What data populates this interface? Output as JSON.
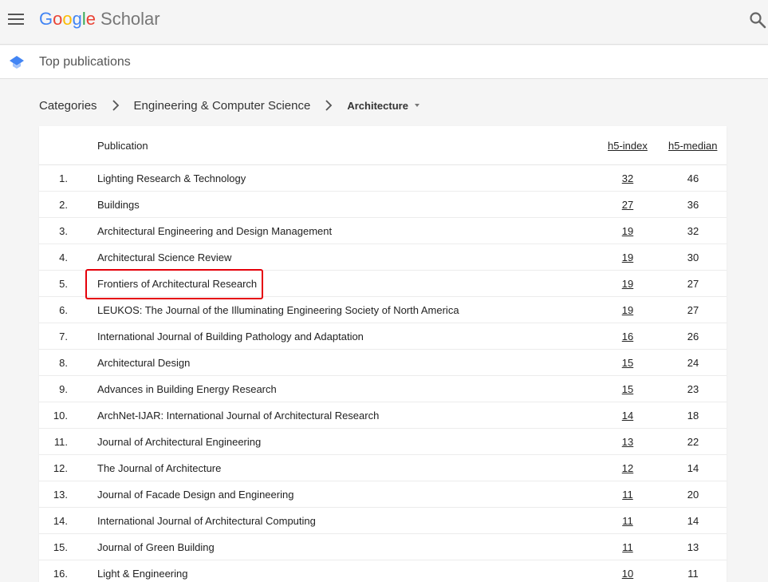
{
  "header": {
    "logo_google": [
      "G",
      "o",
      "o",
      "g",
      "l",
      "e"
    ],
    "logo_scholar": "Scholar",
    "menu_icon": "hamburger-menu-icon",
    "search_icon": "search-icon"
  },
  "subheader": {
    "icon": "mortarboard-icon",
    "title": "Top publications"
  },
  "breadcrumb": {
    "items": [
      "Categories",
      "Engineering & Computer Science"
    ],
    "current": "Architecture"
  },
  "table": {
    "columns": {
      "publication": "Publication",
      "h5_index": "h5-index",
      "h5_median": "h5-median"
    },
    "rows": [
      {
        "rank": "1.",
        "title": "Lighting Research & Technology",
        "h5_index": "32",
        "h5_median": "46"
      },
      {
        "rank": "2.",
        "title": "Buildings",
        "h5_index": "27",
        "h5_median": "36"
      },
      {
        "rank": "3.",
        "title": "Architectural Engineering and Design Management",
        "h5_index": "19",
        "h5_median": "32"
      },
      {
        "rank": "4.",
        "title": "Architectural Science Review",
        "h5_index": "19",
        "h5_median": "30"
      },
      {
        "rank": "5.",
        "title": "Frontiers of Architectural Research",
        "h5_index": "19",
        "h5_median": "27"
      },
      {
        "rank": "6.",
        "title": "LEUKOS: The Journal of the Illuminating Engineering Society of North America",
        "h5_index": "19",
        "h5_median": "27"
      },
      {
        "rank": "7.",
        "title": "International Journal of Building Pathology and Adaptation",
        "h5_index": "16",
        "h5_median": "26"
      },
      {
        "rank": "8.",
        "title": "Architectural Design",
        "h5_index": "15",
        "h5_median": "24"
      },
      {
        "rank": "9.",
        "title": "Advances in Building Energy Research",
        "h5_index": "15",
        "h5_median": "23"
      },
      {
        "rank": "10.",
        "title": "ArchNet-IJAR: International Journal of Architectural Research",
        "h5_index": "14",
        "h5_median": "18"
      },
      {
        "rank": "11.",
        "title": "Journal of Architectural Engineering",
        "h5_index": "13",
        "h5_median": "22"
      },
      {
        "rank": "12.",
        "title": "The Journal of Architecture",
        "h5_index": "12",
        "h5_median": "14"
      },
      {
        "rank": "13.",
        "title": "Journal of Facade Design and Engineering",
        "h5_index": "11",
        "h5_median": "20"
      },
      {
        "rank": "14.",
        "title": "International Journal of Architectural Computing",
        "h5_index": "11",
        "h5_median": "14"
      },
      {
        "rank": "15.",
        "title": "Journal of Green Building",
        "h5_index": "11",
        "h5_median": "13"
      },
      {
        "rank": "16.",
        "title": "Light & Engineering",
        "h5_index": "10",
        "h5_median": "11"
      }
    ]
  },
  "colors": {
    "google_blue": "#4285f4",
    "google_red": "#ea4335",
    "google_yellow": "#fbbc05",
    "google_green": "#34a853",
    "highlight": "#e5000a"
  }
}
